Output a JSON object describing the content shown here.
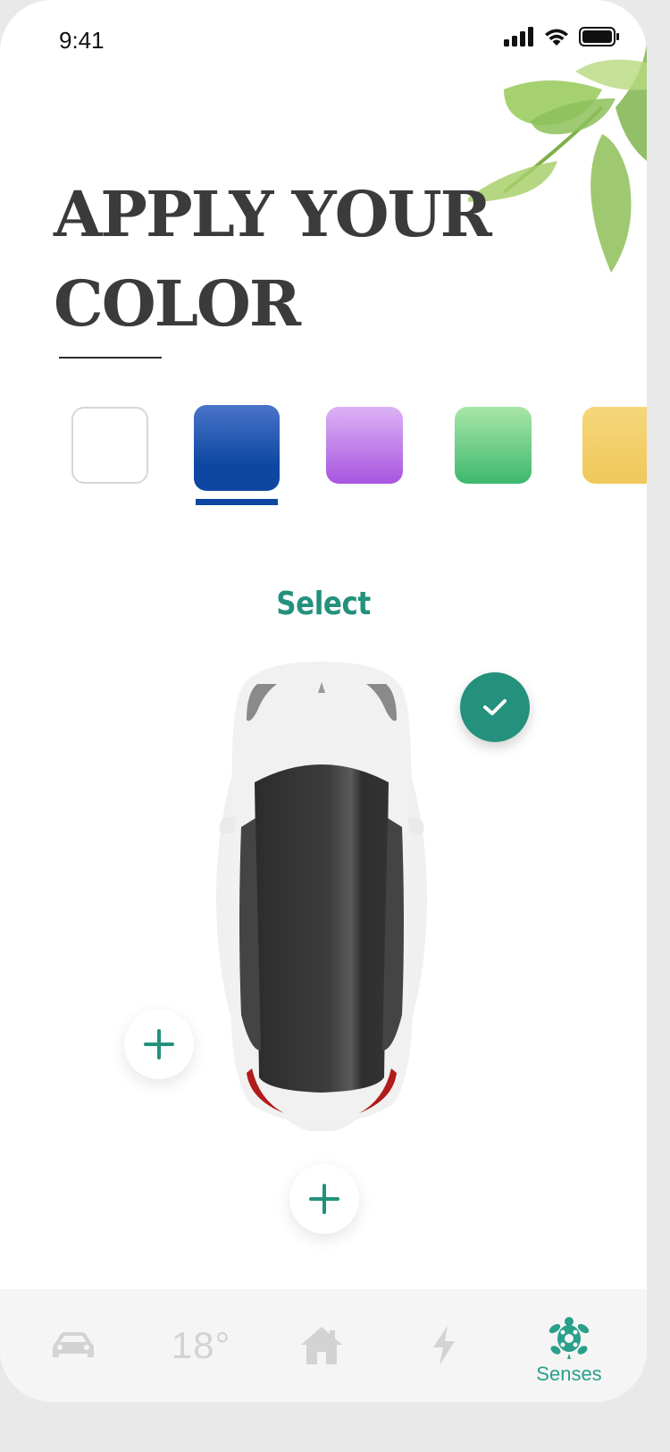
{
  "status_bar": {
    "time": "9:41"
  },
  "page": {
    "title": "APPLY YOUR COLOR",
    "select_label": "Select"
  },
  "swatches": [
    {
      "name": "white",
      "color": "#ffffff",
      "selected": false
    },
    {
      "name": "blue",
      "color": "#0d47a1",
      "selected": true
    },
    {
      "name": "purple",
      "color": "#a855e0",
      "selected": false
    },
    {
      "name": "green",
      "color": "#4cc07a",
      "selected": false
    },
    {
      "name": "yellow",
      "color": "#f2cd5c",
      "selected": false
    }
  ],
  "colors": {
    "accent": "#23917c",
    "title": "#3b3b3b",
    "tab_inactive": "#d3d3d3"
  },
  "tabbar": {
    "items": [
      {
        "icon": "car-icon"
      },
      {
        "label": "18°"
      },
      {
        "icon": "home-icon"
      },
      {
        "icon": "lightning-icon"
      },
      {
        "icon": "turtle-icon",
        "label": "Senses",
        "active": true
      }
    ]
  }
}
